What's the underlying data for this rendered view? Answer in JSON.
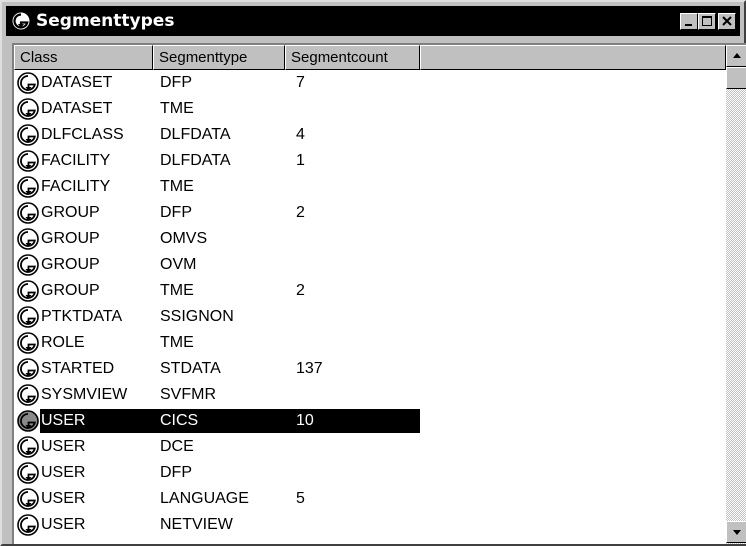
{
  "window": {
    "title": "Segmenttypes",
    "icon": "racf-segment-icon",
    "controls": [
      "minimize-icon",
      "maximize-icon",
      "close-icon"
    ]
  },
  "list": {
    "columns": [
      "Class",
      "Segmenttype",
      "Segmentcount"
    ],
    "row_icon": "segment-item-icon",
    "rows": [
      {
        "class": "DATASET",
        "segmenttype": "DFP",
        "segmentcount": "7",
        "selected": false
      },
      {
        "class": "DATASET",
        "segmenttype": "TME",
        "segmentcount": "",
        "selected": false
      },
      {
        "class": "DLFCLASS",
        "segmenttype": "DLFDATA",
        "segmentcount": "4",
        "selected": false
      },
      {
        "class": "FACILITY",
        "segmenttype": "DLFDATA",
        "segmentcount": "1",
        "selected": false
      },
      {
        "class": "FACILITY",
        "segmenttype": "TME",
        "segmentcount": "",
        "selected": false
      },
      {
        "class": "GROUP",
        "segmenttype": "DFP",
        "segmentcount": "2",
        "selected": false
      },
      {
        "class": "GROUP",
        "segmenttype": "OMVS",
        "segmentcount": "",
        "selected": false
      },
      {
        "class": "GROUP",
        "segmenttype": "OVM",
        "segmentcount": "",
        "selected": false
      },
      {
        "class": "GROUP",
        "segmenttype": "TME",
        "segmentcount": "2",
        "selected": false
      },
      {
        "class": "PTKTDATA",
        "segmenttype": "SSIGNON",
        "segmentcount": "",
        "selected": false
      },
      {
        "class": "ROLE",
        "segmenttype": "TME",
        "segmentcount": "",
        "selected": false
      },
      {
        "class": "STARTED",
        "segmenttype": "STDATA",
        "segmentcount": "137",
        "selected": false
      },
      {
        "class": "SYSMVIEW",
        "segmenttype": "SVFMR",
        "segmentcount": "",
        "selected": false
      },
      {
        "class": "USER",
        "segmenttype": "CICS",
        "segmentcount": "10",
        "selected": true
      },
      {
        "class": "USER",
        "segmenttype": "DCE",
        "segmentcount": "",
        "selected": false
      },
      {
        "class": "USER",
        "segmenttype": "DFP",
        "segmentcount": "",
        "selected": false
      },
      {
        "class": "USER",
        "segmenttype": "LANGUAGE",
        "segmentcount": "5",
        "selected": false
      },
      {
        "class": "USER",
        "segmenttype": "NETVIEW",
        "segmentcount": "",
        "selected": false
      }
    ]
  },
  "scrollbar": {
    "up_icon": "scroll-up-arrow-icon",
    "down_icon": "scroll-down-arrow-icon"
  }
}
